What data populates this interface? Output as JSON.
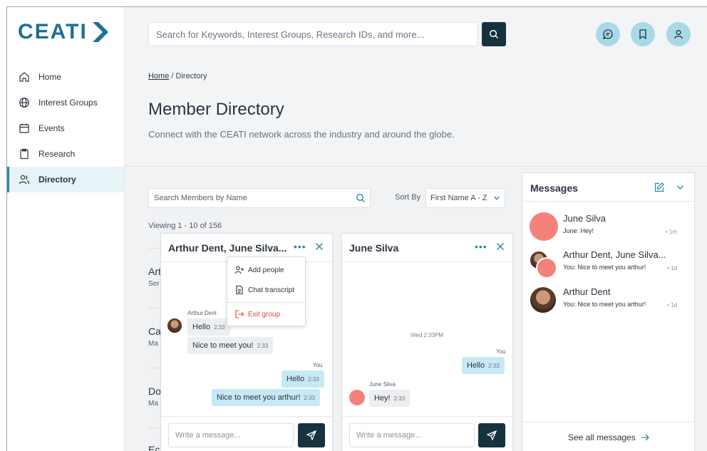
{
  "brand": {
    "logo_text": "CEATI"
  },
  "sidebar": {
    "items": [
      {
        "label": "Home",
        "icon": "home-icon"
      },
      {
        "label": "Interest Groups",
        "icon": "globe-icon"
      },
      {
        "label": "Events",
        "icon": "calendar-icon"
      },
      {
        "label": "Research",
        "icon": "clipboard-icon"
      },
      {
        "label": "Directory",
        "icon": "users-icon",
        "active": true
      }
    ]
  },
  "topbar": {
    "search_placeholder": "Search for Keywords, Interest Groups, Research IDs, and more..."
  },
  "header": {
    "breadcrumb_home": "Home",
    "breadcrumb_sep": " / ",
    "breadcrumb_current": "Directory",
    "title": "Member Directory",
    "subtitle": "Connect with the CEATI network across the industry and around the globe."
  },
  "directory": {
    "search_placeholder": "Search Members by Name",
    "sort_label": "Sort By",
    "sort_value": "First Name A - Z",
    "viewing": "Viewing 1 - 10 of 156",
    "members": [
      {
        "name": "Art",
        "org": "Ser"
      },
      {
        "name": "Ca",
        "org": "Ma"
      },
      {
        "name": "Do",
        "org": "Ma"
      },
      {
        "name": "Ec",
        "org": ""
      }
    ]
  },
  "chat_group": {
    "title": "Arthur Dent, June Silva...",
    "sender_name": "Arthur Dent",
    "you_label": "You",
    "messages": [
      {
        "text": "Hello",
        "time": "2:33"
      },
      {
        "text": "Nice to meet you!",
        "time": "2:33"
      },
      {
        "text": "Hello",
        "time": "2:33"
      },
      {
        "text": "Nice to meet you arthur!",
        "time": "2:33"
      }
    ],
    "input_placeholder": "Write a message..."
  },
  "group_menu": {
    "add_people": "Add people",
    "chat_transcript": "Chat transcript",
    "exit_group": "Exit group"
  },
  "chat_june": {
    "title": "June Silva",
    "day_stamp": "Wed 2:33PM",
    "you_label": "You",
    "sender_name": "June Silva",
    "messages": [
      {
        "text": "Hello",
        "time": "2:33"
      },
      {
        "text": "Hey!",
        "time": "2:33"
      }
    ],
    "input_placeholder": "Write a message..."
  },
  "messages_panel": {
    "title": "Messages",
    "conversations": [
      {
        "name": "June Silva",
        "preview": "June: Hey!",
        "time": "• 1m"
      },
      {
        "name": "Arthur Dent, June Silva...",
        "preview": "You: Nice to meet you arthur!",
        "time": "• 1d"
      },
      {
        "name": "Arthur Dent",
        "preview": "You: Nice to meet you arthur!",
        "time": "• 1d"
      }
    ],
    "see_all": "See all messages"
  },
  "colors": {
    "brand": "#1f6f94",
    "accent": "#2a8aa8",
    "dark_button": "#17323f",
    "icon_circle": "#a9d9e7",
    "avatar_red": "#f4827a",
    "outgoing_bubble": "#c6eaf5",
    "danger": "#d8453b"
  }
}
